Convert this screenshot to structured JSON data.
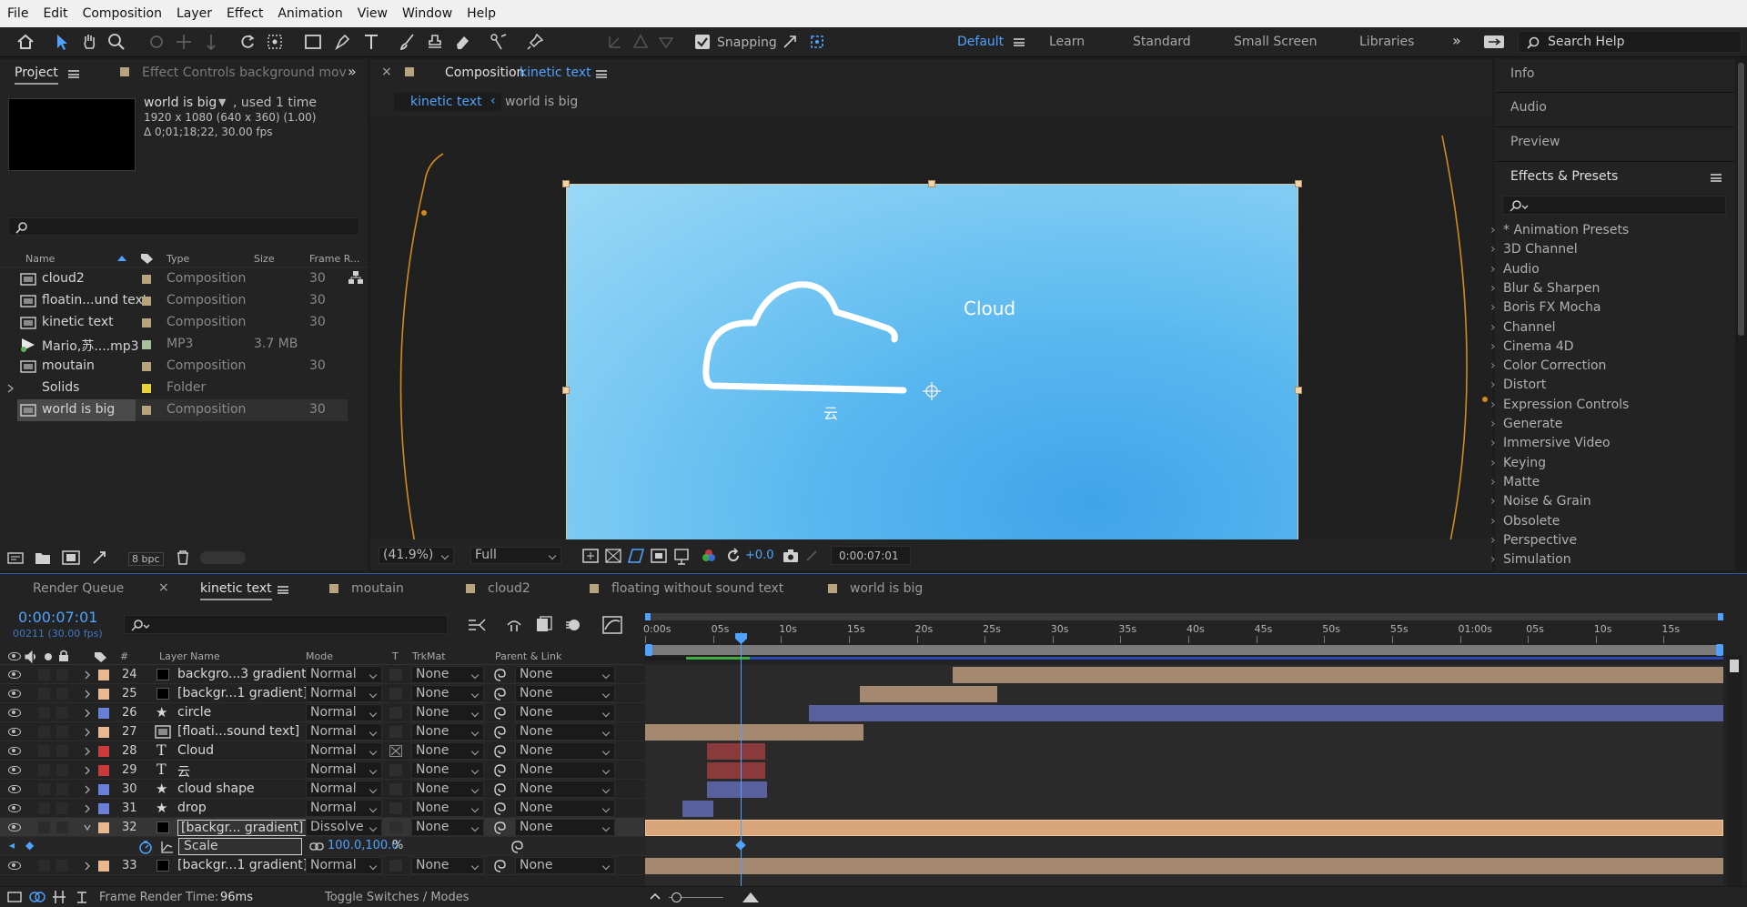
{
  "menu": [
    "File",
    "Edit",
    "Composition",
    "Layer",
    "Effect",
    "Animation",
    "View",
    "Window",
    "Help"
  ],
  "toolbar": {
    "snapping_label": "Snapping",
    "workspaces": [
      "Default",
      "Learn",
      "Standard",
      "Small Screen",
      "Libraries"
    ],
    "active_workspace": "Default",
    "search_placeholder": "Search Help"
  },
  "project_panel": {
    "tab_project": "Project",
    "tab_effect_controls": "Effect Controls background mov",
    "preview_name": "world is big",
    "preview_used": ", used 1 time",
    "preview_dims": "1920 x 1080  (640 x 360) (1.00)",
    "preview_duration": "Δ 0;01;18;22, 30.00 fps",
    "columns": {
      "name": "Name",
      "type": "Type",
      "size": "Size",
      "frame_rate": "Frame R..."
    },
    "items": [
      {
        "name": "cloud2",
        "type": "Composition",
        "size": "",
        "fps": "30",
        "color": "#b7a37d"
      },
      {
        "name": "floatin...und text",
        "type": "Composition",
        "size": "",
        "fps": "30",
        "color": "#b7a37d"
      },
      {
        "name": "kinetic text",
        "type": "Composition",
        "size": "",
        "fps": "30",
        "color": "#b7a37d"
      },
      {
        "name": "Mario,苏....mp3",
        "type": "MP3",
        "size": "3.7 MB",
        "fps": "",
        "color": "#a8c0a0"
      },
      {
        "name": "moutain",
        "type": "Composition",
        "size": "",
        "fps": "30",
        "color": "#b7a37d"
      },
      {
        "name": "Solids",
        "type": "Folder",
        "size": "",
        "fps": "",
        "color": "#e6d23c"
      },
      {
        "name": "world is big",
        "type": "Composition",
        "size": "",
        "fps": "30",
        "color": "#b7a37d"
      }
    ],
    "bpc": "8 bpc"
  },
  "comp_panel": {
    "tab_prefix": "Composition",
    "tab_name": "kinetic text",
    "breadcrumb": [
      "kinetic text",
      "world is big"
    ],
    "canvas_text_en": "Cloud",
    "canvas_text_zh": "云",
    "zoom": "(41.9%)",
    "resolution": "Full",
    "exposure": "+0.0",
    "timecode": "0:00:07:01"
  },
  "right_panel": {
    "tabs": [
      "Info",
      "Audio",
      "Preview"
    ],
    "effects_title": "Effects & Presets",
    "effects": [
      "* Animation Presets",
      "3D Channel",
      "Audio",
      "Blur & Sharpen",
      "Boris FX Mocha",
      "Channel",
      "Cinema 4D",
      "Color Correction",
      "Distort",
      "Expression Controls",
      "Generate",
      "Immersive Video",
      "Keying",
      "Matte",
      "Noise & Grain",
      "Obsolete",
      "Perspective",
      "Simulation"
    ]
  },
  "timeline": {
    "tabs": [
      "Render Queue",
      "kinetic text",
      "moutain",
      "cloud2",
      "floating without sound text",
      "world is big"
    ],
    "active_tab": "kinetic text",
    "timecode": "0:00:07:01",
    "frames": "00211 (30.00 fps)",
    "columns": {
      "layer_name": "Layer Name",
      "mode": "Mode",
      "t": "T",
      "trkmat": "TrkMat",
      "parent": "Parent & Link"
    },
    "ruler": [
      "0:00s",
      "05s",
      "10s",
      "15s",
      "20s",
      "25s",
      "30s",
      "35s",
      "40s",
      "45s",
      "50s",
      "55s",
      "01:00s",
      "05s",
      "10s",
      "15s"
    ],
    "playhead_seconds": 7.03,
    "ruler_end_seconds": 79,
    "layers": [
      {
        "num": "24",
        "name": "backgro...3 gradient",
        "icon": "solid",
        "mode": "Normal",
        "trk": "None",
        "parent": "None",
        "label": "#e9b88f",
        "start": 22.5,
        "end": 79,
        "bar": "#a48870"
      },
      {
        "num": "25",
        "name": "[backgr...1 gradient]",
        "icon": "solid",
        "mode": "Normal",
        "trk": "None",
        "parent": "None",
        "label": "#e9b88f",
        "start": 15.7,
        "end": 25.8,
        "bar": "#a48870"
      },
      {
        "num": "26",
        "name": "circle",
        "icon": "star",
        "mode": "Normal",
        "trk": "None",
        "parent": "None",
        "label": "#6a7fd8",
        "start": 12,
        "end": 79,
        "bar": "#58609e"
      },
      {
        "num": "27",
        "name": "[floati...sound text]",
        "icon": "comp",
        "mode": "Normal",
        "trk": "None",
        "parent": "None",
        "label": "#e9b88f",
        "start": 0,
        "end": 16,
        "bar": "#a48870"
      },
      {
        "num": "28",
        "name": "Cloud",
        "icon": "text",
        "mode": "Normal",
        "trk": "None",
        "parent": "None",
        "label": "#c93a3a",
        "start": 4.5,
        "end": 8.8,
        "bar": "#8a3a3a"
      },
      {
        "num": "29",
        "name": "云",
        "icon": "text",
        "mode": "Normal",
        "trk": "None",
        "parent": "None",
        "label": "#c93a3a",
        "start": 4.5,
        "end": 8.8,
        "bar": "#8a3a3a"
      },
      {
        "num": "30",
        "name": "cloud shape",
        "icon": "star",
        "mode": "Normal",
        "trk": "None",
        "parent": "None",
        "label": "#6a7fd8",
        "start": 4.5,
        "end": 8.9,
        "bar": "#58609e"
      },
      {
        "num": "31",
        "name": "drop",
        "icon": "star",
        "mode": "Normal",
        "trk": "None",
        "parent": "None",
        "label": "#6a7fd8",
        "start": 2.7,
        "end": 5,
        "bar": "#58609e"
      },
      {
        "num": "32",
        "name": "[backgr... gradient]",
        "icon": "solid",
        "mode": "Dissolve",
        "trk": "None",
        "parent": "None",
        "label": "#e9b88f",
        "start": 0,
        "end": 79,
        "bar": "#d9a57a",
        "selected": true
      },
      {
        "num": "33",
        "name": "[backgr...1 gradient]",
        "icon": "solid",
        "mode": "Normal",
        "trk": "None",
        "parent": "None",
        "label": "#e9b88f",
        "start": 0,
        "end": 79,
        "bar": "#a48870"
      }
    ],
    "scale_property": {
      "label": "Scale",
      "value": "100.0,100.0",
      "unit": "%"
    },
    "frame_render_label": "Frame Render Time:",
    "frame_render_value": "96ms",
    "toggle_label": "Toggle Switches / Modes"
  }
}
